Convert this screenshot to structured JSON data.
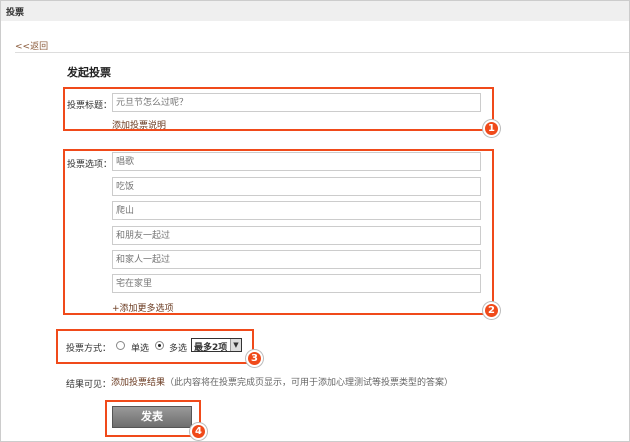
{
  "header": {
    "title": "投票"
  },
  "back_link": "<<返回",
  "page_title": "发起投票",
  "title_field": {
    "label": "投票标题：",
    "placeholder": "元旦节怎么过呢？",
    "add_desc": "添加投票说明"
  },
  "options": {
    "label": "投票选项：",
    "items": [
      "唱歌",
      "吃饭",
      "爬山",
      "和朋友一起过",
      "和家人一起过",
      "宅在家里"
    ],
    "add_more": "+添加更多选项"
  },
  "vote_mode": {
    "label": "投票方式：",
    "single": "单选",
    "multi": "多选",
    "selected": "multi",
    "max_select": "最多2项"
  },
  "result": {
    "label": "结果可见：",
    "link": "添加投票结果",
    "note": "（此内容将在投票完成页显示，可用于添加心理测试等投票类型的答案）"
  },
  "submit": "发表",
  "badges": [
    "1",
    "2",
    "3",
    "4"
  ],
  "accent": "#f04a1a"
}
